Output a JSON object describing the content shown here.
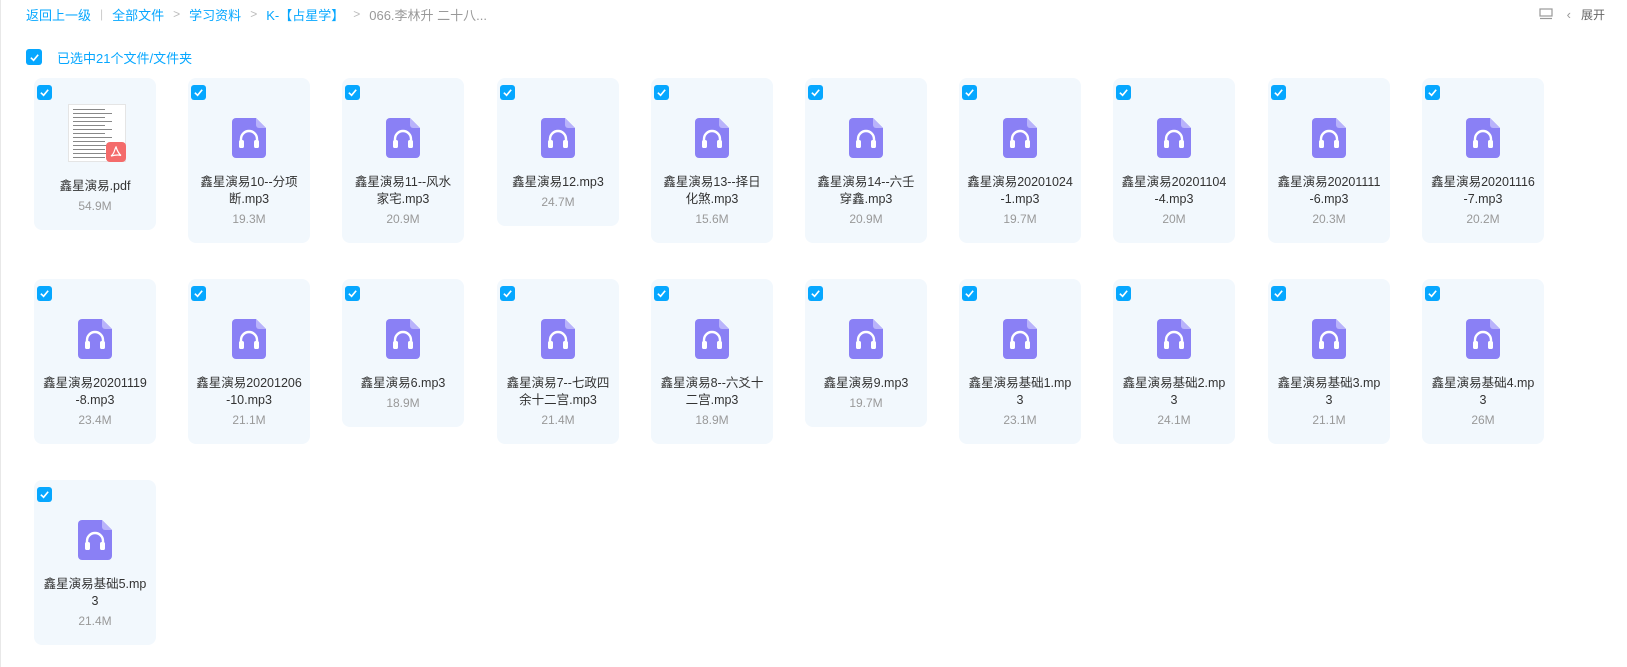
{
  "breadcrumb": {
    "back": "返回上一级",
    "items": [
      "全部文件",
      "学习资料",
      "K-【占星学】",
      "066.李林升 二十八..."
    ]
  },
  "toolbar": {
    "expand_label": "展开"
  },
  "selection": {
    "label": "已选中21个文件/文件夹",
    "checked": true
  },
  "colors": {
    "accent": "#06a7ff",
    "card_bg": "#f2f8fd",
    "audio_icon": "#8a80f5",
    "pdf_badge": "#f46b6b"
  },
  "files": [
    {
      "name": "鑫星演易.pdf",
      "size": "54.9M",
      "type": "pdf-icon",
      "checked": true
    },
    {
      "name": "鑫星演易10--分项断.mp3",
      "size": "19.3M",
      "type": "audio-icon",
      "checked": true
    },
    {
      "name": "鑫星演易11--风水家宅.mp3",
      "size": "20.9M",
      "type": "audio-icon",
      "checked": true
    },
    {
      "name": "鑫星演易12.mp3",
      "size": "24.7M",
      "type": "audio-icon",
      "checked": true
    },
    {
      "name": "鑫星演易13--择日化煞.mp3",
      "size": "15.6M",
      "type": "audio-icon",
      "checked": true
    },
    {
      "name": "鑫星演易14--六壬穿鑫.mp3",
      "size": "20.9M",
      "type": "audio-icon",
      "checked": true
    },
    {
      "name": "鑫星演易20201024-1.mp3",
      "size": "19.7M",
      "type": "audio-icon",
      "checked": true
    },
    {
      "name": "鑫星演易20201104-4.mp3",
      "size": "20M",
      "type": "audio-icon",
      "checked": true
    },
    {
      "name": "鑫星演易20201111-6.mp3",
      "size": "20.3M",
      "type": "audio-icon",
      "checked": true
    },
    {
      "name": "鑫星演易20201116-7.mp3",
      "size": "20.2M",
      "type": "audio-icon",
      "checked": true
    },
    {
      "name": "鑫星演易20201119-8.mp3",
      "size": "23.4M",
      "type": "audio-icon",
      "checked": true
    },
    {
      "name": "鑫星演易20201206-10.mp3",
      "size": "21.1M",
      "type": "audio-icon",
      "checked": true
    },
    {
      "name": "鑫星演易6.mp3",
      "size": "18.9M",
      "type": "audio-icon",
      "checked": true
    },
    {
      "name": "鑫星演易7--七政四余十二宫.mp3",
      "size": "21.4M",
      "type": "audio-icon",
      "checked": true
    },
    {
      "name": "鑫星演易8--六爻十二宫.mp3",
      "size": "18.9M",
      "type": "audio-icon",
      "checked": true
    },
    {
      "name": "鑫星演易9.mp3",
      "size": "19.7M",
      "type": "audio-icon",
      "checked": true
    },
    {
      "name": "鑫星演易基础1.mp3",
      "size": "23.1M",
      "type": "audio-icon",
      "checked": true
    },
    {
      "name": "鑫星演易基础2.mp3",
      "size": "24.1M",
      "type": "audio-icon",
      "checked": true
    },
    {
      "name": "鑫星演易基础3.mp3",
      "size": "21.1M",
      "type": "audio-icon",
      "checked": true
    },
    {
      "name": "鑫星演易基础4.mp3",
      "size": "26M",
      "type": "audio-icon",
      "checked": true
    },
    {
      "name": "鑫星演易基础5.mp3",
      "size": "21.4M",
      "type": "audio-icon",
      "checked": true
    }
  ]
}
